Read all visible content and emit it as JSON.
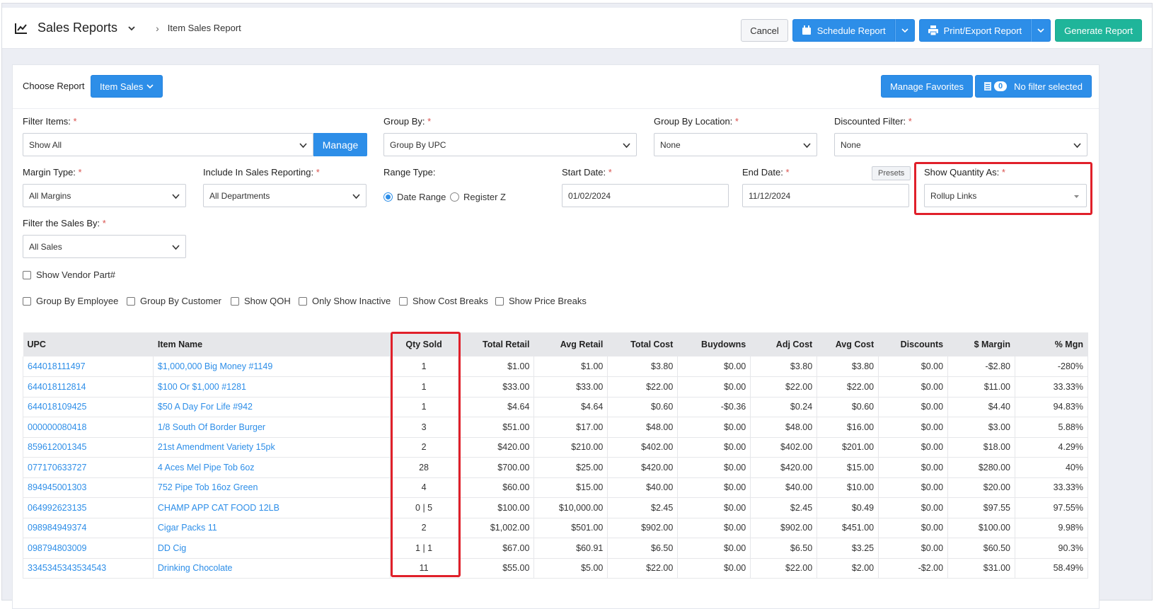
{
  "header": {
    "title": "Sales Reports",
    "breadcrumb": "Item Sales Report",
    "buttons": {
      "cancel": "Cancel",
      "schedule": "Schedule Report",
      "print": "Print/Export Report",
      "generate": "Generate Report"
    }
  },
  "choose": {
    "label": "Choose Report",
    "report": "Item Sales",
    "manage_favorites": "Manage Favorites",
    "filter_count": "0",
    "filter_text": "No filter selected"
  },
  "filters": {
    "filter_items": {
      "label": "Filter Items:",
      "value": "Show All",
      "manage": "Manage"
    },
    "group_by": {
      "label": "Group By:",
      "value": "Group By UPC"
    },
    "group_by_location": {
      "label": "Group By Location:",
      "value": "None"
    },
    "discounted_filter": {
      "label": "Discounted Filter:",
      "value": "None"
    },
    "margin_type": {
      "label": "Margin Type:",
      "value": "All Margins"
    },
    "include_in_sales": {
      "label": "Include In Sales Reporting:",
      "value": "All Departments"
    },
    "range_type": {
      "label": "Range Type:",
      "options": [
        "Date Range",
        "Register Z"
      ],
      "selected": "Date Range"
    },
    "start_date": {
      "label": "Start Date:",
      "value": "01/02/2024"
    },
    "end_date": {
      "label": "End Date:",
      "value": "11/12/2024",
      "presets": "Presets"
    },
    "show_quantity_as": {
      "label": "Show Quantity As:",
      "value": "Rollup Links"
    },
    "filter_sales_by": {
      "label": "Filter the Sales By:",
      "value": "All Sales"
    },
    "required_mark": "*"
  },
  "checkboxes": {
    "vendor_part": "Show Vendor Part#",
    "row": [
      "Group By Employee",
      "Group By Customer",
      "Show QOH",
      "Only Show Inactive",
      "Show Cost Breaks",
      "Show Price Breaks"
    ]
  },
  "table": {
    "headers": [
      "UPC",
      "Item Name",
      "Qty Sold",
      "Total Retail",
      "Avg Retail",
      "Total Cost",
      "Buydowns",
      "Adj Cost",
      "Avg Cost",
      "Discounts",
      "$ Margin",
      "% Mgn"
    ],
    "rows": [
      [
        "644018111497",
        "$1,000,000 Big Money #1149",
        "1",
        "$1.00",
        "$1.00",
        "$3.80",
        "$0.00",
        "$3.80",
        "$3.80",
        "$0.00",
        "-$2.80",
        "-280%"
      ],
      [
        "644018112814",
        "$100 Or $1,000 #1281",
        "1",
        "$33.00",
        "$33.00",
        "$22.00",
        "$0.00",
        "$22.00",
        "$22.00",
        "$0.00",
        "$11.00",
        "33.33%"
      ],
      [
        "644018109425",
        "$50 A Day For Life #942",
        "1",
        "$4.64",
        "$4.64",
        "$0.60",
        "-$0.36",
        "$0.24",
        "$0.60",
        "$0.00",
        "$4.40",
        "94.83%"
      ],
      [
        "000000080418",
        "1/8 South Of Border Burger",
        "3",
        "$51.00",
        "$17.00",
        "$48.00",
        "$0.00",
        "$48.00",
        "$16.00",
        "$0.00",
        "$3.00",
        "5.88%"
      ],
      [
        "859612001345",
        "21st Amendment Variety 15pk",
        "2",
        "$420.00",
        "$210.00",
        "$402.00",
        "$0.00",
        "$402.00",
        "$201.00",
        "$0.00",
        "$18.00",
        "4.29%"
      ],
      [
        "077170633727",
        "4 Aces Mel Pipe Tob 6oz",
        "28",
        "$700.00",
        "$25.00",
        "$420.00",
        "$0.00",
        "$420.00",
        "$15.00",
        "$0.00",
        "$280.00",
        "40%"
      ],
      [
        "894945001303",
        "752 Pipe Tob 16oz Green",
        "4",
        "$60.00",
        "$15.00",
        "$40.00",
        "$0.00",
        "$40.00",
        "$10.00",
        "$0.00",
        "$20.00",
        "33.33%"
      ],
      [
        "064992623135",
        "CHAMP APP CAT FOOD 12LB",
        "0 | 5",
        "$100.00",
        "$10,000.00",
        "$2.45",
        "$0.00",
        "$2.45",
        "$0.49",
        "$0.00",
        "$97.55",
        "97.55%"
      ],
      [
        "098984949374",
        "Cigar Packs 11",
        "2",
        "$1,002.00",
        "$501.00",
        "$902.00",
        "$0.00",
        "$902.00",
        "$451.00",
        "$0.00",
        "$100.00",
        "9.98%"
      ],
      [
        "098794803009",
        "DD Cig",
        "1 | 1",
        "$67.00",
        "$60.91",
        "$6.50",
        "$0.00",
        "$6.50",
        "$3.25",
        "$0.00",
        "$60.50",
        "90.3%"
      ],
      [
        "3345345343534543",
        "Drinking Chocolate",
        "11",
        "$55.00",
        "$5.00",
        "$22.00",
        "$0.00",
        "$22.00",
        "$2.00",
        "-$2.00",
        "$31.00",
        "58.49%"
      ]
    ]
  },
  "colors": {
    "accent": "#2d8ee8",
    "generate": "#1fb59a",
    "highlight": "#e0202a"
  }
}
